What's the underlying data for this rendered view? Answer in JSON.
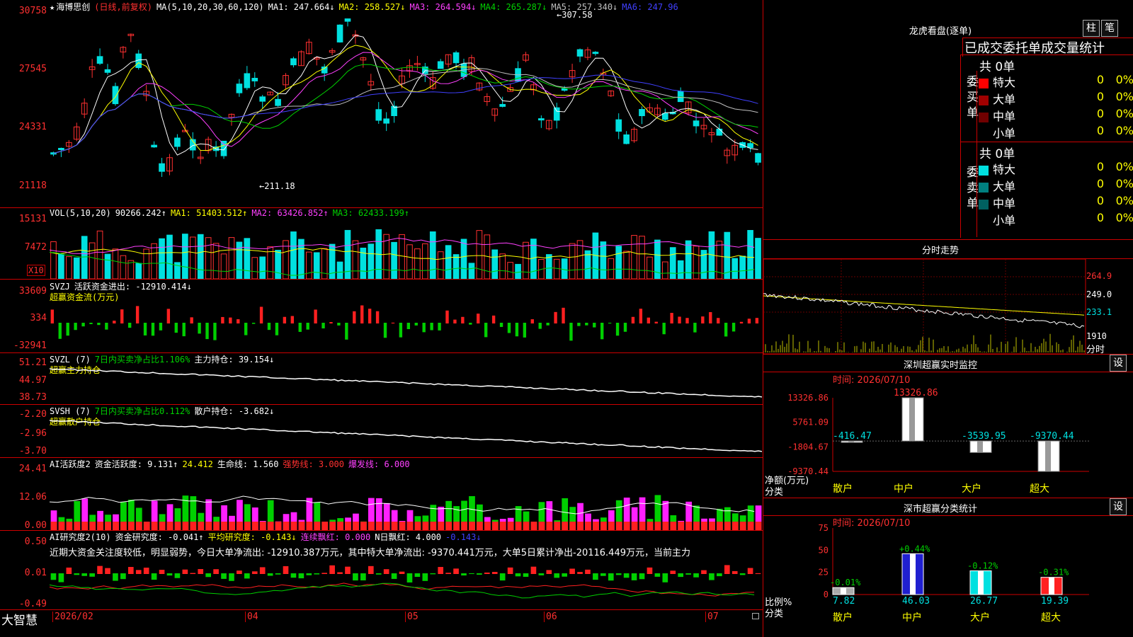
{
  "stock": {
    "star": "★",
    "name": "海博思创",
    "period": "(日线,前复权)"
  },
  "main_chart": {
    "ma_label": "MA(5,10,20,30,60,120)",
    "ma": [
      {
        "label": "MA1: 247.664↓",
        "color": "#ffffff"
      },
      {
        "label": "MA2: 258.527↓",
        "color": "#ffff00"
      },
      {
        "label": "MA3: 264.594↓",
        "color": "#ff40ff"
      },
      {
        "label": "MA4: 265.287↓",
        "color": "#00d000"
      },
      {
        "label": "MA5: 257.340↓",
        "color": "#c0c0c0"
      },
      {
        "label": "MA6: 247.96",
        "color": "#4040ff"
      }
    ],
    "yticks": [
      "30758",
      "27545",
      "24331",
      "21118"
    ],
    "high_mark": "307.58",
    "low_mark": "211.18"
  },
  "vol": {
    "label": "VOL(5,10,20)",
    "value": "90266.242↑",
    "ma1": "MA1: 51403.512↑",
    "ma2": "MA2: 63426.852↑",
    "ma3": "MA3: 62433.199↑",
    "yticks": [
      "15131",
      "7472"
    ],
    "unit": "X10"
  },
  "svzj": {
    "label": "SVZJ",
    "desc": "活跃资金进出: -12910.414↓",
    "sub": "超赢资金流(万元)",
    "yticks": [
      "33609",
      "334",
      "-32941"
    ]
  },
  "svzl": {
    "label": "SVZL (7)",
    "desc1": "7日内买卖净占比1.106%",
    "desc2": "主力持仓: 39.154↓",
    "sub": "超赢主力持仓",
    "yticks": [
      "51.21",
      "44.97",
      "38.73"
    ]
  },
  "svsh": {
    "label": "SVSH (7)",
    "desc1": "7日内买卖净占比0.112%",
    "desc2": "散户持仓: -3.682↓",
    "sub": "超赢散户持仓",
    "yticks": [
      "-2.20",
      "-2.96",
      "-3.70"
    ]
  },
  "ai_act": {
    "label": "AI活跃度2",
    "desc": "资金活跃度: 9.131↑",
    "v2": "24.412",
    "life": "生命线: 1.560",
    "strong": "强势线: 3.000",
    "burst": "爆发线: 6.000",
    "yticks": [
      "24.41",
      "12.06",
      "0.00"
    ]
  },
  "ai_res": {
    "label": "AI研究度2(10)",
    "desc": "资金研究度: -0.041↑",
    "avg": "平均研究度: -0.143↓",
    "red1": "连续飘红: 0.000",
    "red2": "N日飘红: 4.000",
    "neg": "-0.143↓",
    "comment": "近期大资金关注度较低，明显弱势，今日大单净流出: -12910.387万元，其中特大单净流出: -9370.441万元，大单5日累计净出-20116.449万元，当前主力",
    "yticks": [
      "0.50",
      "0.01",
      "-0.49"
    ]
  },
  "xaxis": {
    "brand": "大智慧",
    "labels": [
      "2026/02",
      "04",
      "05",
      "06",
      "07"
    ]
  },
  "right": {
    "longhu": {
      "title": "龙虎看盘(逐单)",
      "btn1": "柱",
      "btn2": "笔",
      "subtitle": "已成交委托单成交量统计",
      "buy": {
        "side": "委买单",
        "total": "共 0单",
        "rows": [
          {
            "name": "特大",
            "count": "0",
            "pct": "0%",
            "color": "#ff0000"
          },
          {
            "name": "大单",
            "count": "0",
            "pct": "0%",
            "color": "#a00000"
          },
          {
            "name": "中单",
            "count": "0",
            "pct": "0%",
            "color": "#700000"
          },
          {
            "name": "小单",
            "count": "0",
            "pct": "0%",
            "color": "#000000"
          }
        ]
      },
      "sell": {
        "side": "委卖单",
        "total": "共 0单",
        "rows": [
          {
            "name": "特大",
            "count": "0",
            "pct": "0%",
            "color": "#00e0e0"
          },
          {
            "name": "大单",
            "count": "0",
            "pct": "0%",
            "color": "#008080"
          },
          {
            "name": "中单",
            "count": "0",
            "pct": "0%",
            "color": "#006060"
          },
          {
            "name": "小单",
            "count": "0",
            "pct": "0%",
            "color": "#000000"
          }
        ]
      }
    },
    "fenshi": {
      "title": "分时走势",
      "yticks": [
        "264.9",
        "249.0",
        "233.1",
        "1910"
      ],
      "unit": "分时"
    },
    "monitor": {
      "title": "深圳超赢实时监控",
      "setting": "设",
      "time": "时间: 2026/07/10",
      "ylabels": [
        "13326.86",
        "5761.09",
        "-1804.67",
        "-9370.44"
      ],
      "axis_title": "净额(万元)",
      "axis_cat": "分类",
      "bars": [
        {
          "cat": "散户",
          "value": "-416.47"
        },
        {
          "cat": "中户",
          "value": "13326.86"
        },
        {
          "cat": "大户",
          "value": "-3539.95"
        },
        {
          "cat": "超大",
          "value": "-9370.44"
        }
      ]
    },
    "classstat": {
      "title": "深市超赢分类统计",
      "setting": "设",
      "time": "时间: 2026/07/10",
      "ylabels": [
        "75",
        "50",
        "25",
        "0"
      ],
      "axis_title": "比例%",
      "axis_cat": "分类",
      "bars": [
        {
          "cat": "散户",
          "change": "-0.01%",
          "value": "7.82"
        },
        {
          "cat": "中户",
          "change": "+0.44%",
          "value": "46.03"
        },
        {
          "cat": "大户",
          "change": "-0.12%",
          "value": "26.77"
        },
        {
          "cat": "超大",
          "change": "-0.31%",
          "value": "19.39"
        }
      ]
    }
  }
}
